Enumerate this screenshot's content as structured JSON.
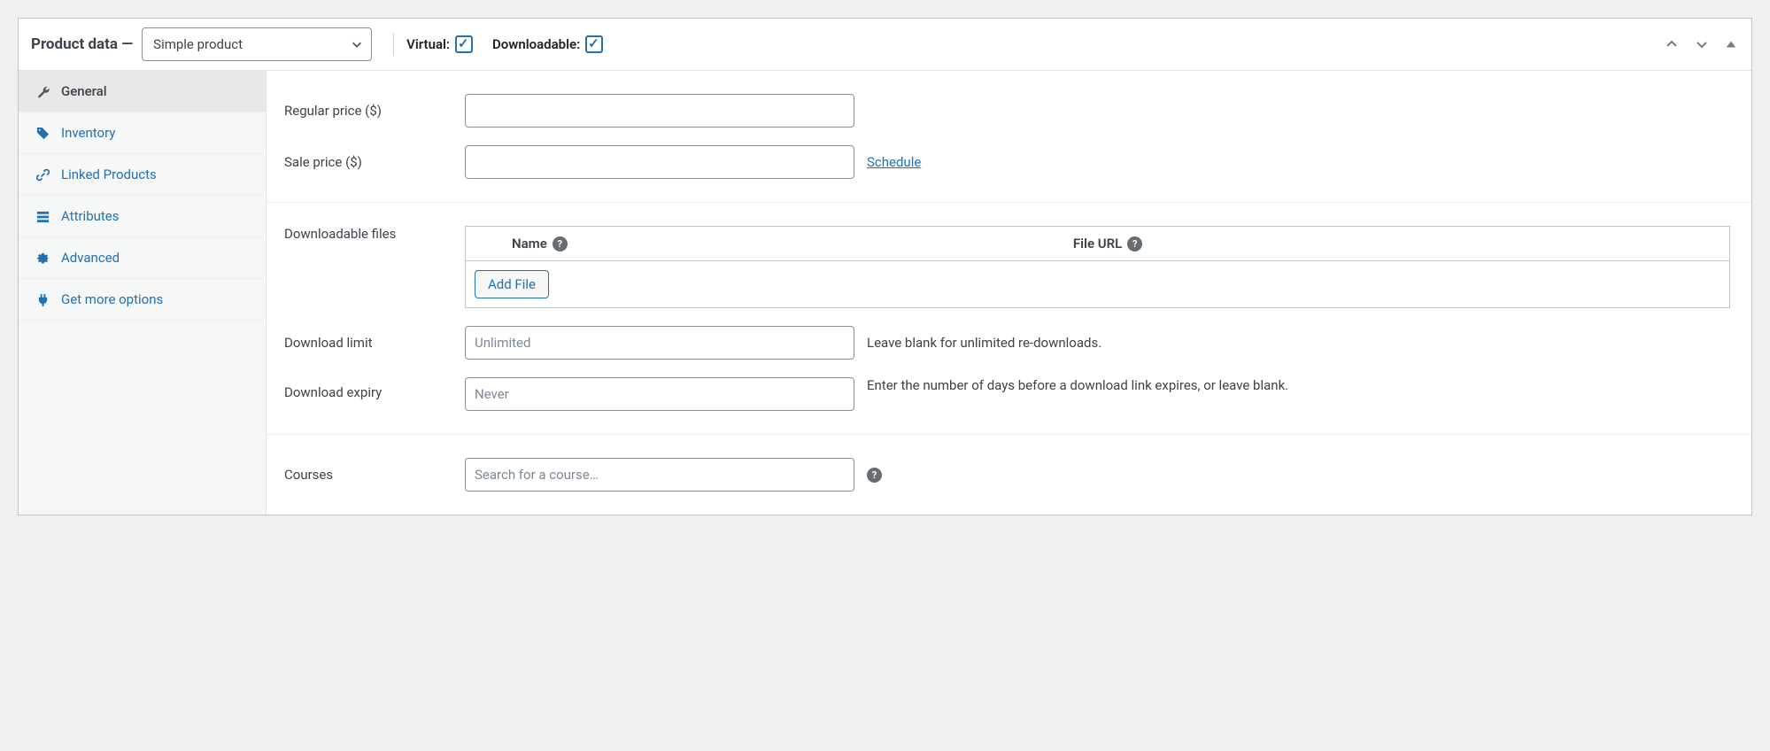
{
  "header": {
    "title": "Product data —",
    "product_type": "Simple product",
    "virtual_label": "Virtual:",
    "virtual_checked": true,
    "downloadable_label": "Downloadable:",
    "downloadable_checked": true
  },
  "tabs": [
    {
      "id": "general",
      "label": "General",
      "icon": "wrench",
      "active": true
    },
    {
      "id": "inventory",
      "label": "Inventory",
      "icon": "tag",
      "active": false
    },
    {
      "id": "linked",
      "label": "Linked Products",
      "icon": "link",
      "active": false
    },
    {
      "id": "attributes",
      "label": "Attributes",
      "icon": "list",
      "active": false
    },
    {
      "id": "advanced",
      "label": "Advanced",
      "icon": "gear",
      "active": false
    },
    {
      "id": "more",
      "label": "Get more options",
      "icon": "plug",
      "active": false
    }
  ],
  "fields": {
    "regular_price_label": "Regular price ($)",
    "regular_price_value": "",
    "sale_price_label": "Sale price ($)",
    "sale_price_value": "",
    "schedule_link": "Schedule",
    "downloadable_files_label": "Downloadable files",
    "files_col_name": "Name",
    "files_col_url": "File URL",
    "add_file_button": "Add File",
    "download_limit_label": "Download limit",
    "download_limit_placeholder": "Unlimited",
    "download_limit_value": "",
    "download_limit_help": "Leave blank for unlimited re-downloads.",
    "download_expiry_label": "Download expiry",
    "download_expiry_placeholder": "Never",
    "download_expiry_value": "",
    "download_expiry_help": "Enter the number of days before a download link expires, or leave blank.",
    "courses_label": "Courses",
    "courses_placeholder": "Search for a course…",
    "courses_value": ""
  }
}
